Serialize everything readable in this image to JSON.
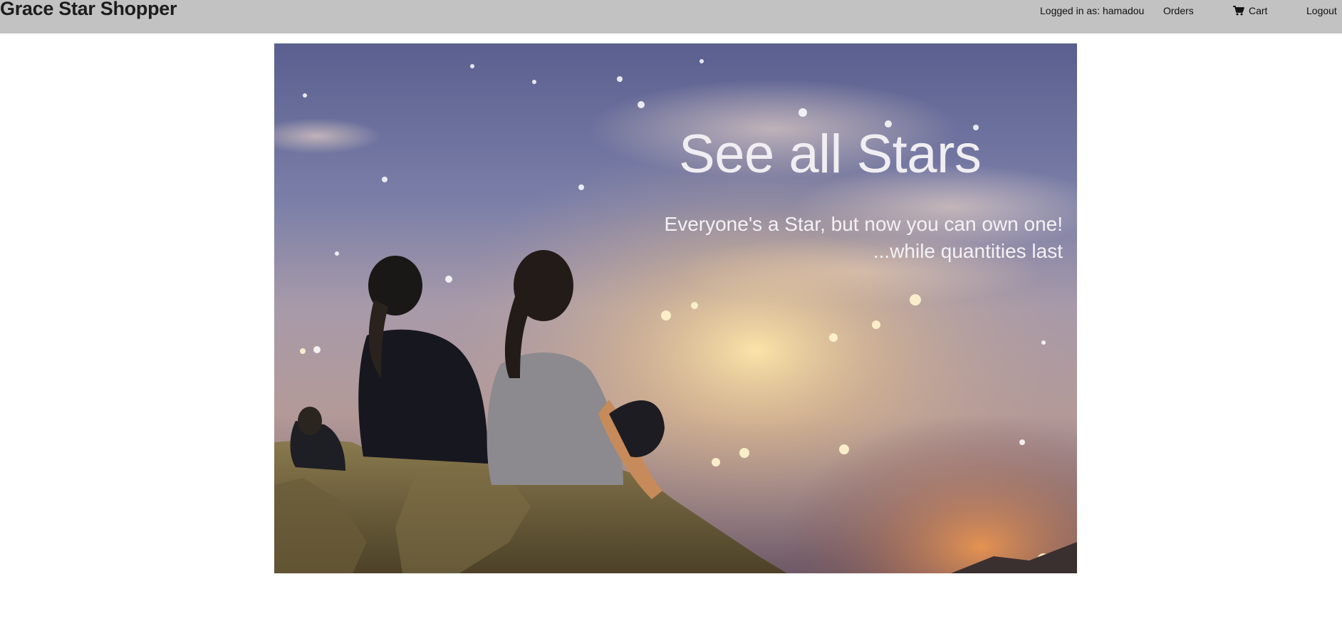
{
  "navbar": {
    "brand": "Grace Star Shopper",
    "logged_in_label": "Logged in as: hamadou",
    "orders_label": "Orders",
    "cart_label": "Cart",
    "logout_label": "Logout",
    "background_color": "#c2c2c2",
    "cart_icon": "shopping-cart-icon"
  },
  "hero": {
    "title": "See all Stars",
    "subtitle_line1": "Everyone's a Star, but now you can own one!",
    "subtitle_line2": "...while quantities last",
    "text_color": "#f1eef2"
  }
}
